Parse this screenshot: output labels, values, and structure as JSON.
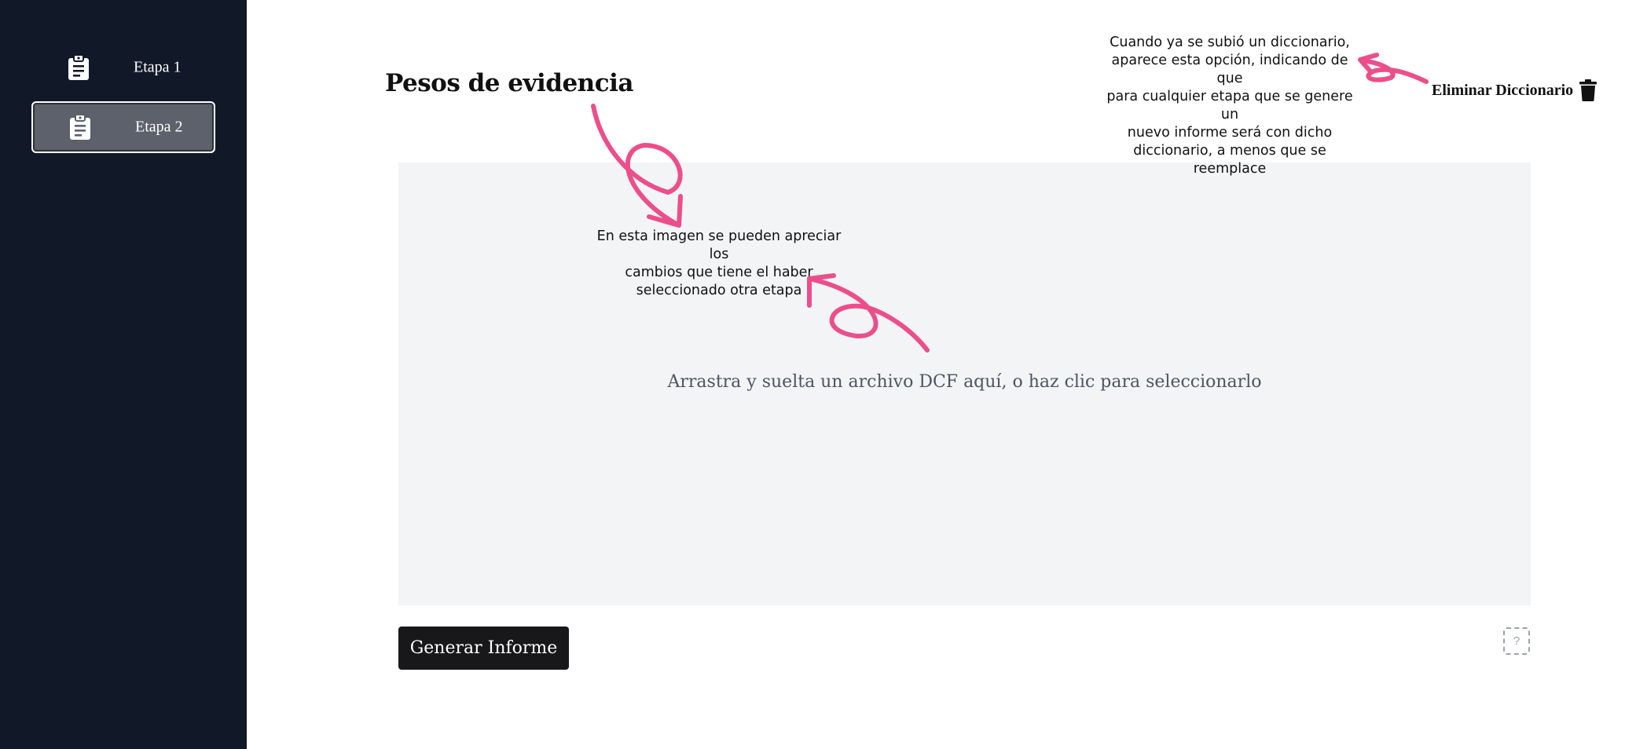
{
  "sidebar": {
    "items": [
      {
        "label": "Etapa 1",
        "icon": "clipboard-list-icon",
        "selected": false
      },
      {
        "label": "Etapa 2",
        "icon": "clipboard-list-icon",
        "selected": true
      }
    ]
  },
  "main": {
    "title": "Pesos de evidencia",
    "delete_label": "Eliminar Diccionario",
    "dropzone_text": "Arrastra y suelta un archivo DCF aquí, o haz clic para seleccionarlo",
    "generate_label": "Generar Informe",
    "help_label": "?"
  },
  "annotations": {
    "top_note": [
      "Cuando ya se subió un diccionario,",
      "aparece esta opción, indicando de que",
      "para cualquier etapa que se genere un",
      "nuevo informe será con dicho",
      "diccionario, a menos que se reemplace"
    ],
    "mid_note": [
      "En esta imagen se pueden apreciar los",
      "cambios que tiene el haber",
      "seleccionado otra etapa"
    ]
  },
  "colors": {
    "sidebar_bg": "#111827",
    "selected_item_bg": "#5c616b",
    "dropzone_bg": "#f3f4f6",
    "button_bg": "#18181b",
    "annotation_pink": "#ec4e8c"
  }
}
